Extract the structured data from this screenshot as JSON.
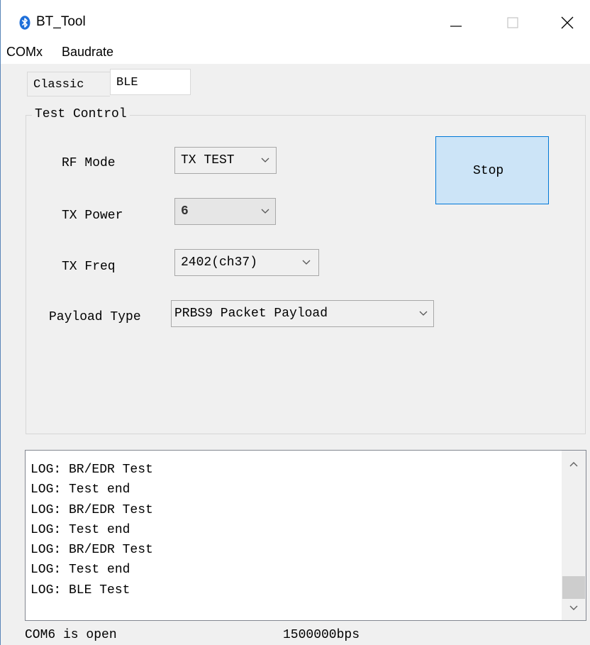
{
  "window": {
    "title": "BT_Tool",
    "icon": "bluetooth-icon",
    "controls": [
      "minimize-icon",
      "maximize-icon",
      "close-icon"
    ]
  },
  "menu": {
    "items": [
      {
        "label": "COMx"
      },
      {
        "label": "Baudrate"
      }
    ]
  },
  "tabs": [
    {
      "label": "Classic",
      "selected": false
    },
    {
      "label": "BLE",
      "selected": true
    }
  ],
  "test_control": {
    "title": "Test Control",
    "rf_mode": {
      "label": "RF Mode",
      "value": "TX TEST"
    },
    "tx_power": {
      "label": "TX Power",
      "value": "6"
    },
    "tx_freq": {
      "label": "TX Freq",
      "value": "2402(ch37)"
    },
    "payload_type": {
      "label": "Payload Type",
      "value": "PRBS9 Packet Payload"
    },
    "stop_label": "Stop"
  },
  "log": {
    "lines": [
      "LOG: BR/EDR Test",
      "LOG: Test end",
      "LOG: BR/EDR Test",
      "LOG: Test end",
      "LOG: BR/EDR Test",
      "LOG: Test end",
      "LOG: BLE Test"
    ]
  },
  "status": {
    "port": "COM6 is open",
    "baud": "1500000bps"
  },
  "colors": {
    "accent": "#0078d7",
    "button_fill": "#cce4f7",
    "bluetooth": "#1e6fd9"
  }
}
